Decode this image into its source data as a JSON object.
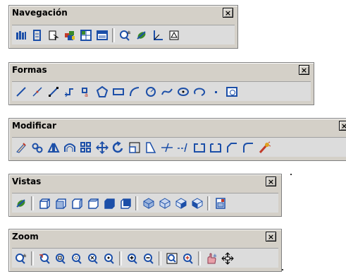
{
  "toolbars": {
    "navegacao": {
      "title": "Navegación",
      "close": "×",
      "buttons": [
        "named-views-icon",
        "3d-orbit-icon",
        "3d-walk-icon",
        "render-icon",
        "viewports-icon",
        "display-icon",
        "zoom-realtime-icon",
        "view-manager-icon",
        "ucs-icon",
        "plot-icon"
      ]
    },
    "formas": {
      "title": "Formas",
      "close": "×",
      "buttons": [
        "line-icon",
        "construction-line-icon",
        "polyline-icon",
        "polyline-arrow-icon",
        "3d-polyline-icon",
        "polygon-icon",
        "rectangle-icon",
        "arc-icon",
        "circle-icon",
        "spline-icon",
        "ellipse-icon",
        "ellipse-arc-icon",
        "point-icon",
        "region-icon"
      ]
    },
    "modificar": {
      "title": "Modificar",
      "close": "×",
      "buttons": [
        "erase-icon",
        "copy-icon",
        "mirror-icon",
        "offset-icon",
        "array-icon",
        "move-icon",
        "rotate-icon",
        "scale-icon",
        "stretch-icon",
        "trim-icon",
        "extend-icon",
        "break-icon",
        "join-icon",
        "chamfer-icon",
        "fillet-icon",
        "explode-icon"
      ]
    },
    "vistas": {
      "title": "Vistas",
      "close": "×",
      "buttons": [
        "3d-orbit-icon",
        "top-view-icon",
        "bottom-view-icon",
        "left-view-icon",
        "right-view-icon",
        "front-view-icon",
        "back-view-icon",
        "sw-iso-icon",
        "se-iso-icon",
        "ne-iso-icon",
        "nw-iso-icon",
        "camera-icon"
      ]
    },
    "zoom": {
      "title": "Zoom",
      "close": "×",
      "buttons": [
        "zoom-realtime-icon",
        "zoom-previous-icon",
        "zoom-window-icon",
        "zoom-dynamic-icon",
        "zoom-scale-icon",
        "zoom-center-icon",
        "zoom-in-icon",
        "zoom-out-icon",
        "zoom-all-icon",
        "zoom-extents-icon",
        "pan-realtime-icon",
        "pan-icon"
      ]
    }
  },
  "colors": {
    "toolbar_bg": "#d4d0c8",
    "icon_blue": "#1c4fa8",
    "icon_green": "#3a8a2a",
    "icon_red": "#c23b2a"
  }
}
